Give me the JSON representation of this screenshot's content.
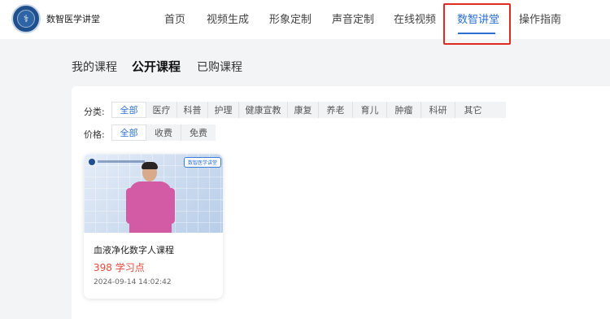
{
  "brand": {
    "name": "数智医学讲堂",
    "logo_icon": "emblem-icon"
  },
  "nav": {
    "items": [
      {
        "label": "首页"
      },
      {
        "label": "视频生成"
      },
      {
        "label": "形象定制"
      },
      {
        "label": "声音定制"
      },
      {
        "label": "在线视频"
      },
      {
        "label": "数智讲堂",
        "active": true
      },
      {
        "label": "操作指南"
      }
    ],
    "accent_color": "#2c6fd1",
    "highlight_color": "#e02a22"
  },
  "course_tabs": [
    {
      "label": "我的课程"
    },
    {
      "label": "公开课程",
      "active": true
    },
    {
      "label": "已购课程"
    }
  ],
  "filters": {
    "category": {
      "label": "分类:",
      "options": [
        "全部",
        "医疗",
        "科普",
        "护理",
        "健康宣教",
        "康复",
        "养老",
        "育儿",
        "肿瘤",
        "科研",
        "其它"
      ],
      "selected": "全部"
    },
    "price": {
      "label": "价格:",
      "options": [
        "全部",
        "收费",
        "免费"
      ],
      "selected": "全部"
    }
  },
  "courses": [
    {
      "title": "血液净化数字人课程",
      "price": "398 学习点",
      "date": "2024-09-14 14:02:42",
      "thumb_tag": "数智医学讲堂",
      "price_color": "#e8473b"
    }
  ]
}
